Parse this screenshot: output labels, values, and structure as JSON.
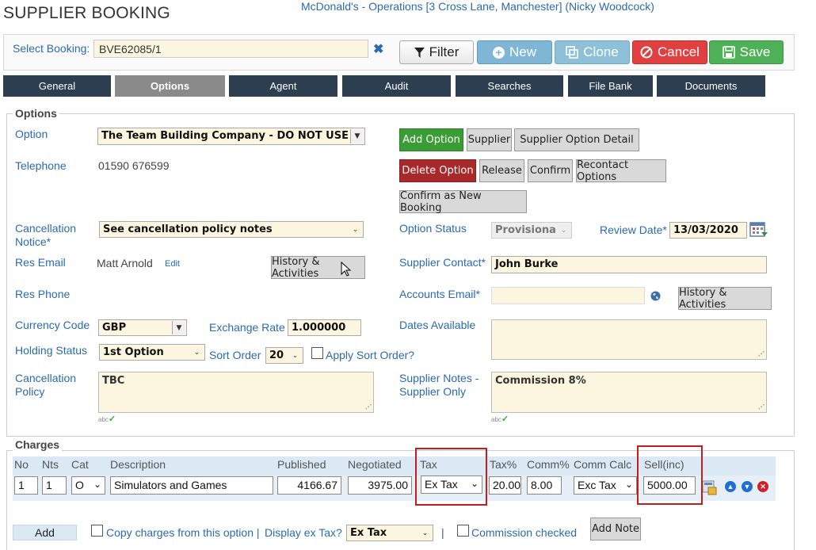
{
  "header": {
    "title": "SUPPLIER BOOKING",
    "context": "McDonald's - Operations [3 Cross Lane, Manchester] (Nicky Woodcock)"
  },
  "topbar": {
    "select_booking_label": "Select Booking:",
    "booking_value": "BVE62085/1",
    "filter": "Filter",
    "new": "New",
    "clone": "Clone",
    "cancel": "Cancel",
    "save": "Save"
  },
  "tabs": [
    "General",
    "Options",
    "Agent",
    "Audit",
    "Searches",
    "File Bank",
    "Documents"
  ],
  "active_tab": "Options",
  "options": {
    "legend": "Options",
    "option_label": "Option",
    "option_value": "The Team Building Company - DO NOT USE",
    "telephone_label": "Telephone",
    "telephone_value": "01590 676599",
    "cancellation_notice_label": "Cancellation Notice*",
    "cancellation_notice_value": "See cancellation policy notes",
    "res_email_label": "Res Email",
    "res_email_value": "Matt Arnold",
    "res_email_edit": "Edit",
    "history_btn": "History & Activities",
    "res_phone_label": "Res Phone",
    "currency_label": "Currency Code",
    "currency_value": "GBP",
    "exchange_label": "Exchange Rate",
    "exchange_value": "1.000000",
    "holding_label": "Holding Status",
    "holding_value": "1st Option",
    "sort_label": "Sort Order",
    "sort_value": "20",
    "apply_sort_label": "Apply Sort Order?",
    "cancel_policy_label": "Cancellation Policy",
    "cancel_policy_value": "TBC",
    "add_option": "Add Option",
    "supplier_btn": "Supplier",
    "supplier_detail_btn": "Supplier Option Detail",
    "delete_option": "Delete Option",
    "release_btn": "Release",
    "confirm_btn": "Confirm",
    "recontact_btn": "Recontact Options",
    "confirm_new_btn": "Confirm as New Booking",
    "option_status_label": "Option Status",
    "option_status_value": "Provisional",
    "review_date_label": "Review Date*",
    "review_date_value": "13/03/2020",
    "supplier_contact_label": "Supplier Contact*",
    "supplier_contact_value": "John Burke",
    "accounts_email_label": "Accounts Email*",
    "accounts_email_value": "",
    "history_btn2": "History & Activities",
    "dates_available_label": "Dates Available",
    "dates_available_value": "",
    "supplier_notes_label": "Supplier Notes - Supplier Only",
    "supplier_notes_value": "Commission 8%"
  },
  "charges": {
    "legend": "Charges",
    "columns": [
      "No",
      "Nts",
      "Cat",
      "Description",
      "Published",
      "Negotiated",
      "Tax",
      "Tax%",
      "Comm%",
      "Comm Calc",
      "Sell(inc)"
    ],
    "row": {
      "no": "1",
      "nts": "1",
      "cat": "O",
      "description": "Simulators and Games",
      "published": "4166.67",
      "negotiated": "3975.00",
      "tax": "Ex Tax",
      "tax_pct": "20.00",
      "comm_pct": "8.00",
      "comm_calc": "Exc Tax",
      "sell_inc": "5000.00"
    },
    "add_btn": "Add",
    "copy_label": "Copy charges from this option |",
    "display_ex_tax_label": "Display ex Tax?",
    "display_ex_tax_value": "Ex Tax",
    "separator": "|",
    "commission_checked_label": "Commission checked",
    "add_note_btn": "Add Note"
  },
  "colors": {
    "link_blue": "#2a6ab0",
    "tab_dark": "#2c3e50",
    "field_bg": "#fcf6e0",
    "highlight_red": "#c81c1c"
  }
}
